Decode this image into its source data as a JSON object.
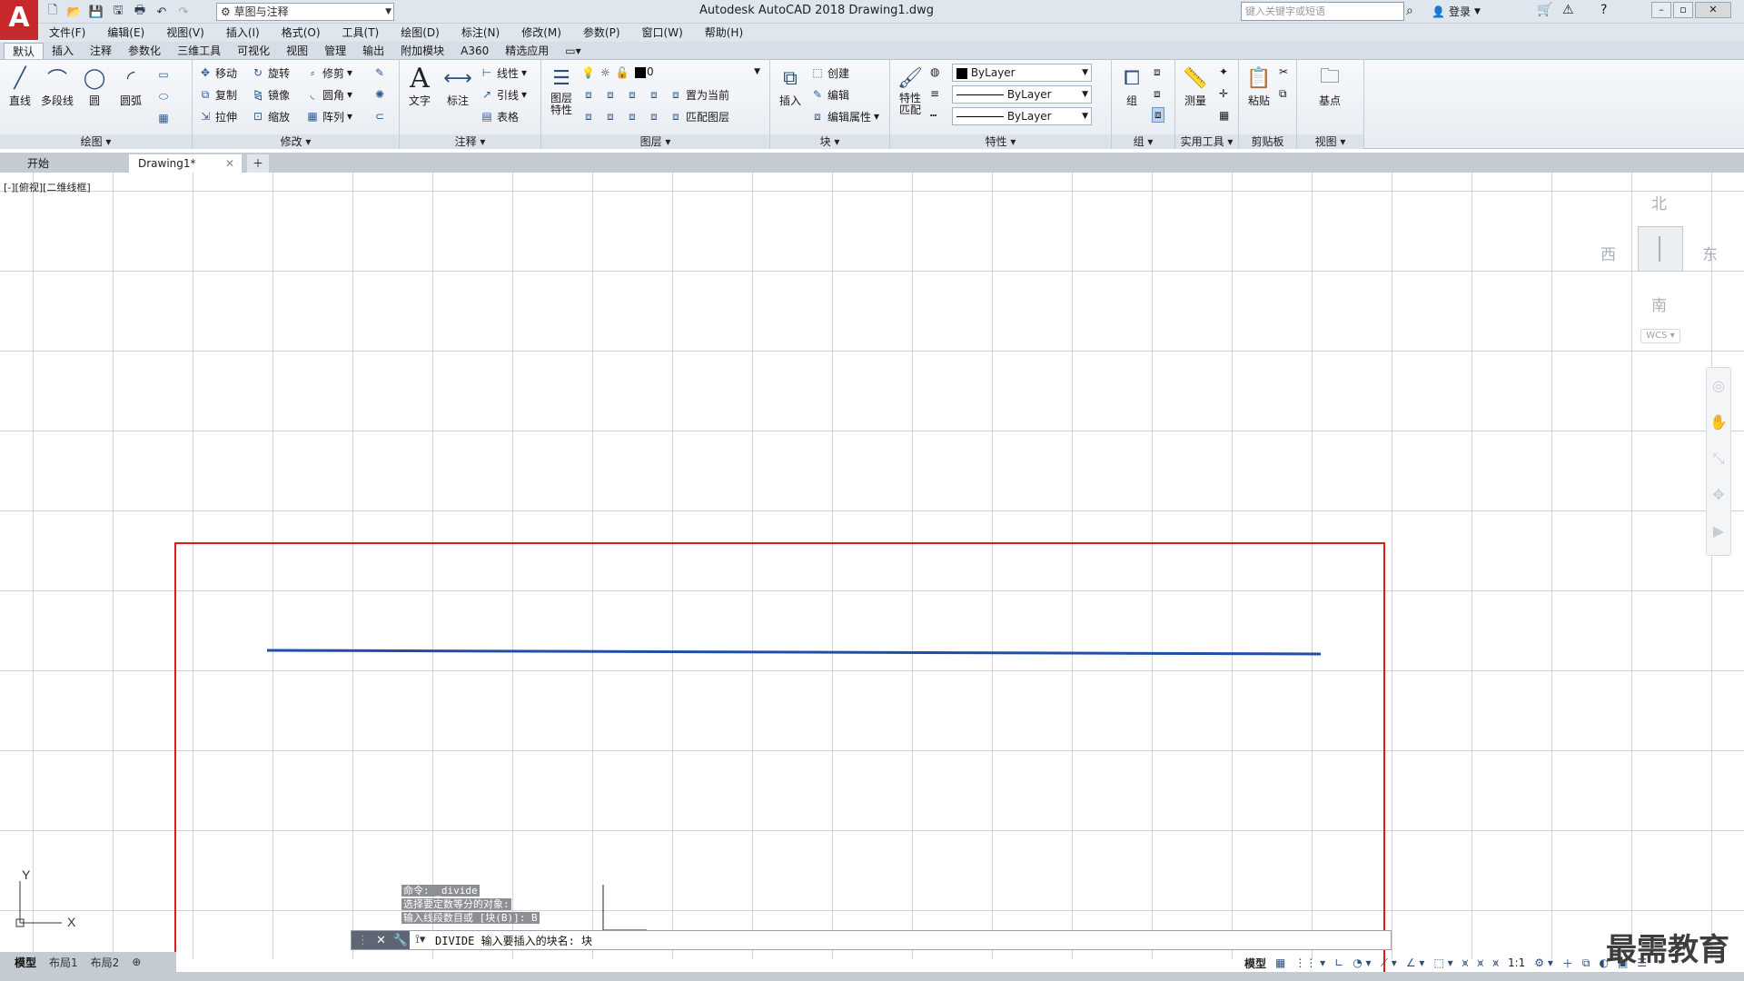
{
  "app": {
    "logo_letter": "A",
    "title": "Autodesk AutoCAD 2018    Drawing1.dwg",
    "workspace": "草图与注释",
    "search_placeholder": "键入关键字或短语",
    "login": "登录"
  },
  "menubar": [
    "文件(F)",
    "编辑(E)",
    "视图(V)",
    "插入(I)",
    "格式(O)",
    "工具(T)",
    "绘图(D)",
    "标注(N)",
    "修改(M)",
    "参数(P)",
    "窗口(W)",
    "帮助(H)"
  ],
  "ribbon_tabs": [
    "默认",
    "插入",
    "注释",
    "参数化",
    "三维工具",
    "可视化",
    "视图",
    "管理",
    "输出",
    "附加模块",
    "A360",
    "精选应用"
  ],
  "ribbon": {
    "draw": {
      "footer": "绘图 ▾",
      "tools": [
        "直线",
        "多段线",
        "圆",
        "圆弧"
      ]
    },
    "modify": {
      "footer": "修改 ▾",
      "tools": [
        "移动",
        "旋转",
        "修剪",
        "复制",
        "镜像",
        "圆角",
        "拉伸",
        "缩放",
        "阵列"
      ]
    },
    "annotation": {
      "footer": "注释 ▾",
      "text": "文字",
      "dim": "标注",
      "linear": "线性",
      "leader": "引线",
      "table": "表格"
    },
    "layers": {
      "footer": "图层 ▾",
      "props": "图层\n特性",
      "layer_value": "0",
      "set_current": "置为当前",
      "match_layer": "匹配图层"
    },
    "block": {
      "footer": "块 ▾",
      "insert": "插入",
      "create": "创建",
      "edit": "编辑",
      "edit_attr": "编辑属性"
    },
    "properties": {
      "footer": "特性 ▾",
      "match": "特性\n匹配",
      "color": "ByLayer",
      "linetype": "ByLayer",
      "lineweight": "ByLayer"
    },
    "groups": {
      "footer": "组 ▾",
      "group": "组"
    },
    "utilities": {
      "footer": "实用工具 ▾",
      "measure": "测量"
    },
    "clipboard": {
      "footer": "剪贴板",
      "paste": "粘贴"
    },
    "view": {
      "footer": "视图 ▾",
      "base": "基点"
    }
  },
  "file_tabs": [
    "开始",
    "Drawing1*"
  ],
  "viewport_label": "[-][俯视][二维线框]",
  "viewcube": {
    "north": "北",
    "south": "南",
    "east": "东",
    "west": "西",
    "wcs": "WCS"
  },
  "ucs": {
    "x": "X",
    "y": "Y"
  },
  "command_history": [
    "命令: _divide",
    "选择要定数等分的对象:",
    "输入线段数目或 [块(B)]: B"
  ],
  "command_line": "DIVIDE 输入要插入的块名: 块",
  "layout_tabs": [
    "模型",
    "布局1",
    "布局2"
  ],
  "status": {
    "model": "模型",
    "scale": "1:1"
  },
  "watermark": "最需教育",
  "colors": {
    "accent_red": "#e0191b",
    "line_blue": "#1f4fa8",
    "logo_red": "#c6282b"
  }
}
